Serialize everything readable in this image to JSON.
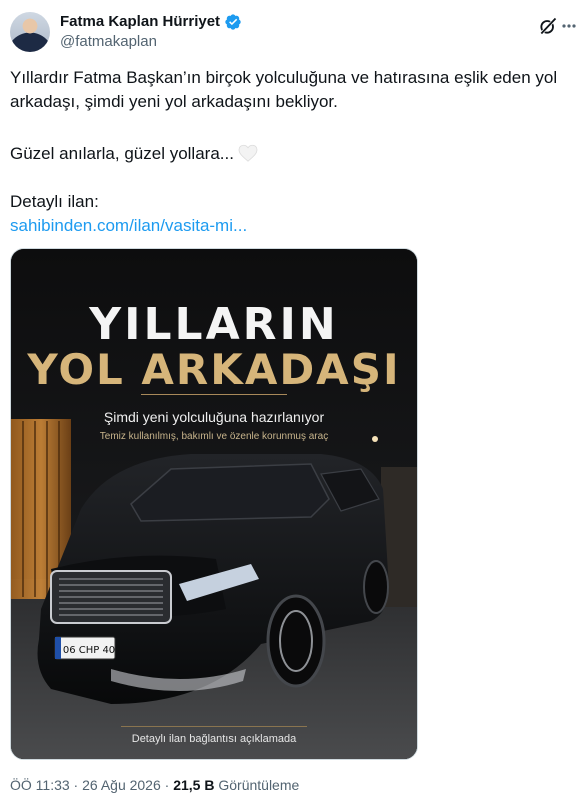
{
  "author": {
    "display_name": "Fatma Kaplan Hürriyet",
    "handle": "@fatmakaplan"
  },
  "icons": {
    "verified": "verified-badge-icon",
    "grok": "grok-icon",
    "more": "more-icon",
    "heart": "white-heart-icon"
  },
  "tweet": {
    "paragraph1": "Yıllardır Fatma Başkan’ın birçok yolculuğuna ve hatırasına eşlik eden yol arkadaşı, şimdi yeni yol arkadaşını bekliyor.",
    "paragraph2": "Güzel anılarla, güzel yollara...",
    "paragraph3": "Detaylı ilan:",
    "link_text": "sahibinden.com/ilan/vasita-mi..."
  },
  "media": {
    "headline_line1": "YILLARIN",
    "headline_line2": "YOL ARKADAŞI",
    "subtitle": "Şimdi yeni yolculuğuna hazırlanıyor",
    "tagline": "Temiz kullanılmış, bakımlı ve özenle korunmuş araç",
    "plate": "06 CHP 40",
    "footer": "Detaylı ilan bağlantısı açıklamada"
  },
  "meta": {
    "time": "ÖÖ 11:33",
    "separator1": " · ",
    "date": "26 Ağu 2026",
    "separator2": " · ",
    "views_count": "21,5 B",
    "views_label": " Görüntüleme"
  },
  "colors": {
    "link": "#1d9bf0",
    "verified": "#1d9bf0",
    "gold": "#d6b57a",
    "secondary_text": "#536471"
  }
}
